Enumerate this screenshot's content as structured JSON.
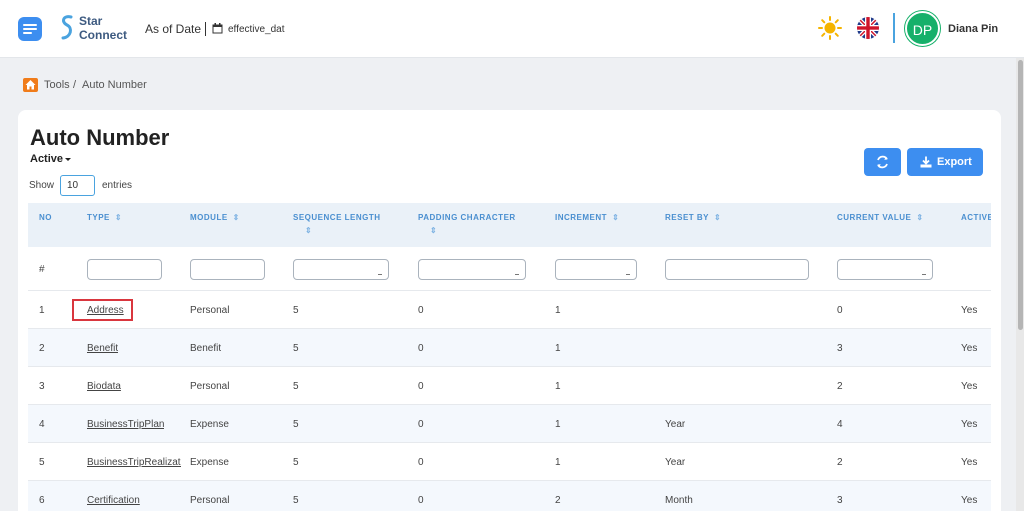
{
  "header": {
    "logo_line1": "Star",
    "logo_line2": "Connect",
    "as_of_label": "As of Date",
    "date_value": "effective_dat",
    "user_initials": "DP",
    "user_name": "Diana Pin",
    "icons": [
      "menu-icon",
      "calendar-icon",
      "sun-icon",
      "uk-flag-icon"
    ]
  },
  "breadcrumb": {
    "items": [
      "Tools",
      "Auto Number"
    ],
    "separator": "/"
  },
  "page": {
    "title": "Auto Number",
    "status_filter": "Active",
    "show_label": "Show",
    "entries_value": "10",
    "entries_label": "entries",
    "export_label": "Export"
  },
  "table": {
    "columns": [
      "NO",
      "TYPE",
      "MODULE",
      "SEQUENCE LENGTH",
      "PADDING CHARACTER",
      "INCREMENT",
      "RESET BY",
      "CURRENT VALUE",
      "ACTIVE"
    ],
    "filter_hash": "#",
    "rows": [
      {
        "no": "1",
        "type": "Address",
        "module": "Personal",
        "seq": "5",
        "pad": "0",
        "inc": "1",
        "reset": "",
        "current": "0",
        "active": "Yes"
      },
      {
        "no": "2",
        "type": "Benefit",
        "module": "Benefit",
        "seq": "5",
        "pad": "0",
        "inc": "1",
        "reset": "",
        "current": "3",
        "active": "Yes"
      },
      {
        "no": "3",
        "type": "Biodata",
        "module": "Personal",
        "seq": "5",
        "pad": "0",
        "inc": "1",
        "reset": "",
        "current": "2",
        "active": "Yes"
      },
      {
        "no": "4",
        "type": "BusinessTripPlan",
        "module": "Expense",
        "seq": "5",
        "pad": "0",
        "inc": "1",
        "reset": "Year",
        "current": "4",
        "active": "Yes"
      },
      {
        "no": "5",
        "type": "BusinessTripRealizati",
        "module": "Expense",
        "seq": "5",
        "pad": "0",
        "inc": "1",
        "reset": "Year",
        "current": "2",
        "active": "Yes"
      },
      {
        "no": "6",
        "type": "Certification",
        "module": "Personal",
        "seq": "5",
        "pad": "0",
        "inc": "2",
        "reset": "Month",
        "current": "3",
        "active": "Yes"
      }
    ]
  },
  "colors": {
    "primary": "#3d8ef0",
    "header_text": "#4a8fd0",
    "avatar": "#16b06a",
    "highlight": "#d9363e",
    "home": "#f07c1a"
  }
}
